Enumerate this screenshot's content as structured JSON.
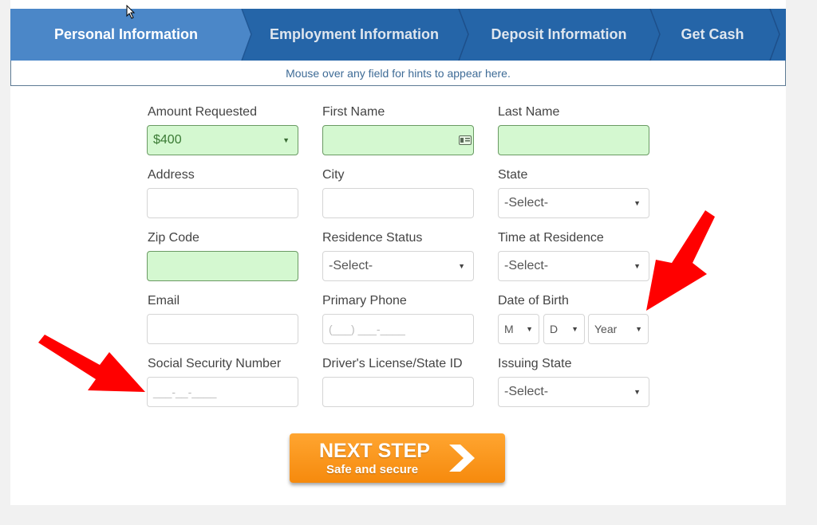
{
  "steps": [
    {
      "label": "Personal Information",
      "active": true
    },
    {
      "label": "Employment Information",
      "active": false
    },
    {
      "label": "Deposit Information",
      "active": false
    },
    {
      "label": "Get Cash",
      "active": false
    }
  ],
  "hint": "Mouse over any field for hints to appear here.",
  "form": {
    "amount_requested": {
      "label": "Amount Requested",
      "value": "$400"
    },
    "first_name": {
      "label": "First Name",
      "value": ""
    },
    "last_name": {
      "label": "Last Name",
      "value": ""
    },
    "address": {
      "label": "Address",
      "value": ""
    },
    "city": {
      "label": "City",
      "value": ""
    },
    "state": {
      "label": "State",
      "value": "-Select-"
    },
    "zip_code": {
      "label": "Zip Code",
      "value": ""
    },
    "residence_status": {
      "label": "Residence Status",
      "value": "-Select-"
    },
    "time_at_residence": {
      "label": "Time at Residence",
      "value": "-Select-"
    },
    "email": {
      "label": "Email",
      "value": ""
    },
    "primary_phone": {
      "label": "Primary Phone",
      "placeholder": "(___) ___-____"
    },
    "date_of_birth": {
      "label": "Date of Birth",
      "month": "M",
      "day": "D",
      "year": "Year"
    },
    "ssn": {
      "label": "Social Security Number",
      "placeholder": "___-__-____"
    },
    "drivers_license": {
      "label": "Driver's License/State ID",
      "value": ""
    },
    "issuing_state": {
      "label": "Issuing State",
      "value": "-Select-"
    }
  },
  "next_button": {
    "title": "NEXT STEP",
    "subtitle": "Safe and secure"
  },
  "colors": {
    "step_active": "#4b87c8",
    "step_inactive": "#2565a8",
    "valid_field": "#d4f8d0",
    "cta": "#f68a0d",
    "annotation_arrow": "#ff0000"
  }
}
